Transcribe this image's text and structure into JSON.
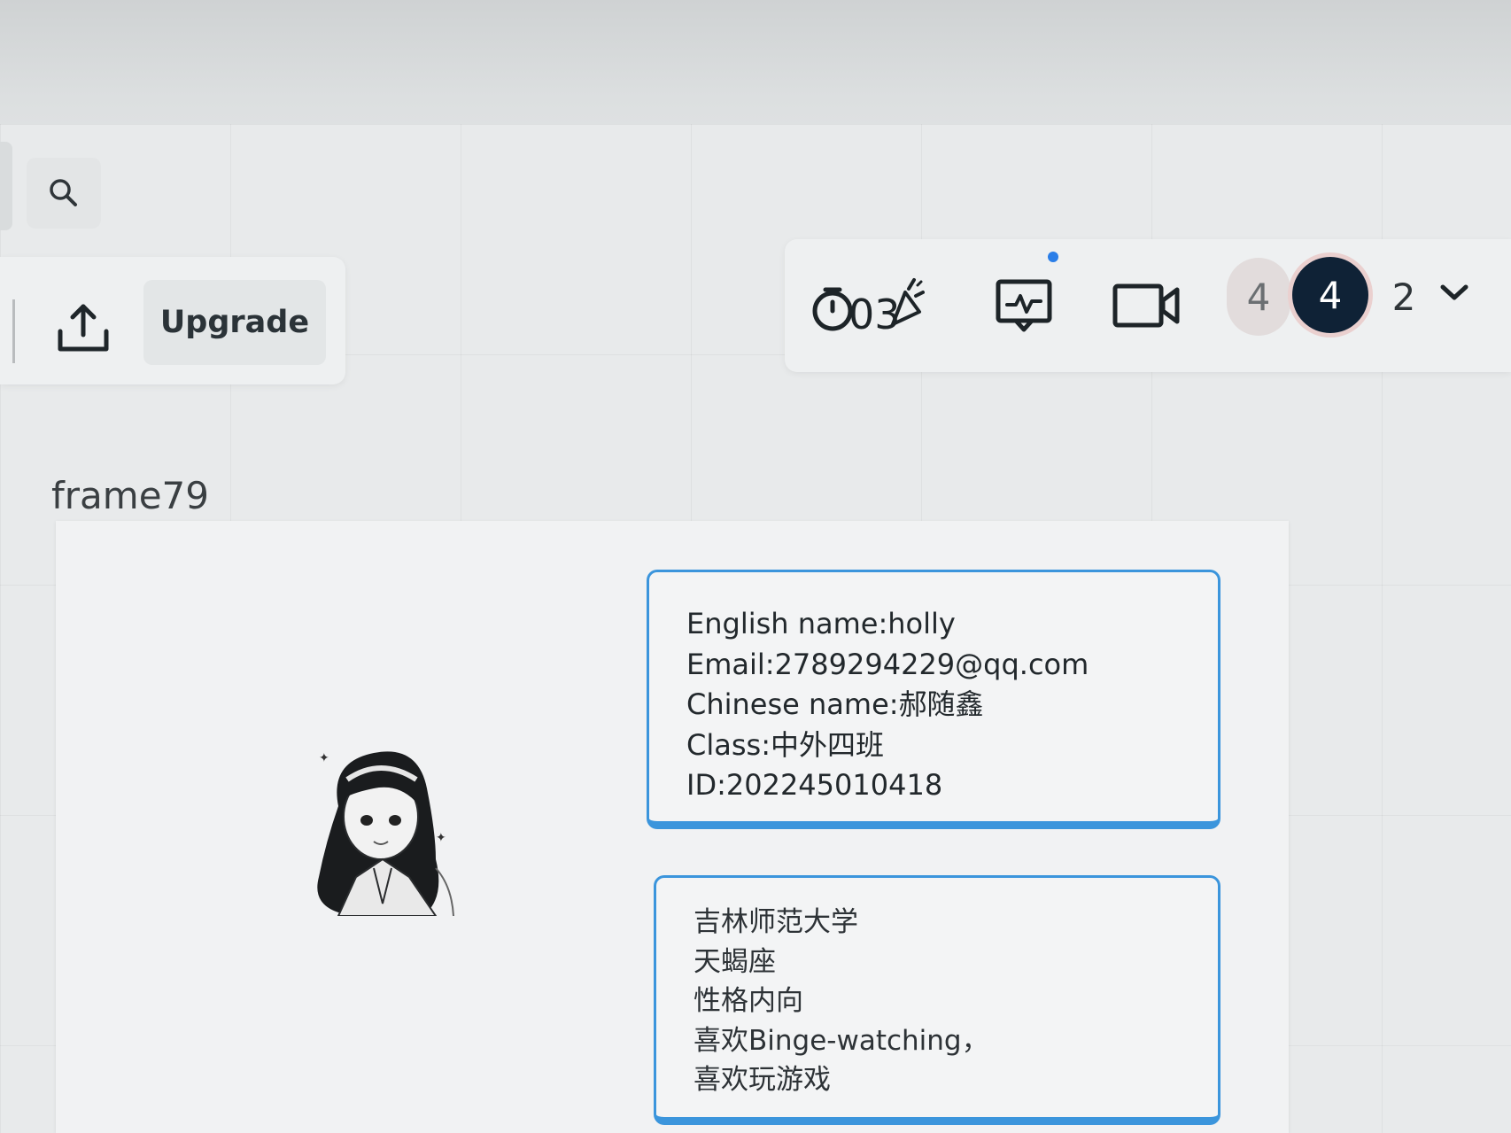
{
  "toolbar": {
    "upgrade_label": "Upgrade",
    "search_icon": "search-icon",
    "share_icon": "upload-icon",
    "timer_icon": "timer-icon",
    "reactions_icon": "party-popper-icon",
    "timer_value": "03",
    "presentation_icon": "presentation-chart-icon",
    "video_icon": "video-camera-icon",
    "collaborators_count": "4",
    "active_user_count": "4",
    "viewers_count": "2",
    "dropdown_icon": "chevron-down-icon"
  },
  "colors": {
    "card_border": "#3b95dc",
    "notification_dot": "#2a7ee8",
    "avatar_dark": "#0f2236"
  },
  "frame": {
    "name": "frame79",
    "info_card": {
      "lines": [
        "English name:holly",
        "Email:2789294229@qq.com",
        "Chinese name:郝随鑫",
        "Class:中外四班",
        "ID:202245010418"
      ]
    },
    "about_card": {
      "lines": [
        "吉林师范大学",
        "天蝎座",
        "性格内向",
        "喜欢Binge-watching，",
        "喜欢玩游戏"
      ]
    }
  }
}
